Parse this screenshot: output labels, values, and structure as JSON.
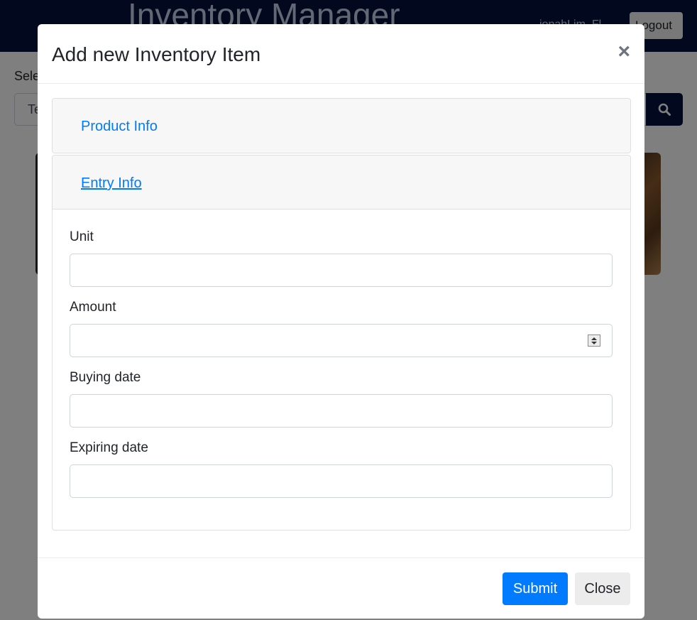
{
  "app": {
    "title": "Inventory Manager",
    "user": "jonahLim_Fl",
    "logout_label": "Logout"
  },
  "background": {
    "select_label": "Sele",
    "search_value": "Te"
  },
  "modal": {
    "title": "Add new Inventory Item",
    "close_icon": "×",
    "sections": [
      {
        "label": "Product Info",
        "expanded": false
      },
      {
        "label": "Entry Info",
        "expanded": true
      }
    ],
    "fields": [
      {
        "label": "Unit",
        "value": "",
        "type": "text"
      },
      {
        "label": "Amount",
        "value": "",
        "type": "number"
      },
      {
        "label": "Buying date",
        "value": "",
        "type": "text"
      },
      {
        "label": "Expiring date",
        "value": "",
        "type": "text"
      }
    ],
    "submit_label": "Submit",
    "close_label": "Close"
  },
  "colors": {
    "navbar": "#04133f",
    "primary": "#007bff",
    "link": "#007bff"
  }
}
